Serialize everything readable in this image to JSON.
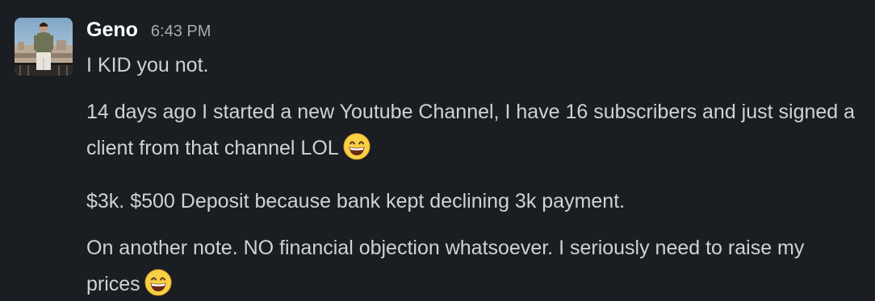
{
  "message": {
    "sender": "Geno",
    "timestamp": "6:43 PM",
    "paragraphs": [
      "I KID you not.",
      "14 days ago I started a new Youtube Channel, I have 16 subscribers and just signed a client from that channel LOL",
      "$3k. $500 Deposit because bank kept declining 3k payment.",
      "On another note. NO financial objection whatsoever. I seriously need to raise my prices"
    ],
    "emoji_icon": "grinning-smile-emoji",
    "colors": {
      "background": "#1a1d21",
      "text": "#d1d2d3",
      "sender": "#ffffff",
      "timestamp": "#ababad"
    }
  }
}
